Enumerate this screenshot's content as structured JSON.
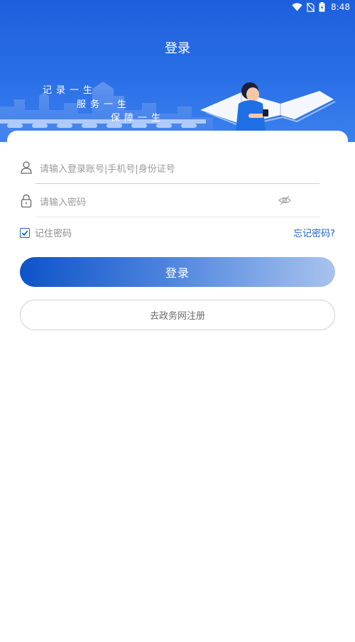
{
  "status_bar": {
    "time": "8:48"
  },
  "nav": {
    "title": "登录"
  },
  "banner": {
    "slogans": [
      "记录一生",
      "服务一生",
      "保障一生"
    ]
  },
  "form": {
    "account_placeholder": "请输入登录账号|手机号|身份证号",
    "password_placeholder": "请输入密码",
    "remember_label": "记住密码",
    "remember_checked": true,
    "forgot_label": "忘记密码?",
    "login_label": "登录",
    "register_label": "去政务网注册"
  },
  "colors": {
    "header": "#2a6fe6",
    "accent": "#1f5fc8"
  }
}
